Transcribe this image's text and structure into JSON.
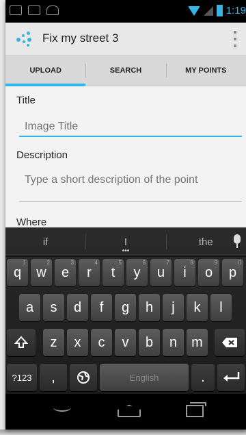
{
  "status_bar": {
    "time": "1:19",
    "icons": [
      "keyboard-icon",
      "image-icon",
      "android-icon",
      "wifi-icon",
      "signal-icon",
      "battery-icon"
    ]
  },
  "action_bar": {
    "title": "Fix my street 3",
    "icon": "app-dots-icon",
    "overflow_icon": "overflow-menu-icon"
  },
  "tabs": [
    {
      "label": "UPLOAD",
      "active": true
    },
    {
      "label": "SEARCH",
      "active": false
    },
    {
      "label": "MY POINTS",
      "active": false
    }
  ],
  "form": {
    "title_label": "Title",
    "title_placeholder": "Image Title",
    "description_label": "Description",
    "description_placeholder": "Type a short description of the point",
    "where_label": "Where"
  },
  "keyboard": {
    "suggestions": [
      "if",
      "I",
      "the"
    ],
    "row1": [
      {
        "key": "q",
        "hint": "1"
      },
      {
        "key": "w",
        "hint": "2"
      },
      {
        "key": "e",
        "hint": "3"
      },
      {
        "key": "r",
        "hint": "4"
      },
      {
        "key": "t",
        "hint": "5"
      },
      {
        "key": "y",
        "hint": "6"
      },
      {
        "key": "u",
        "hint": "7"
      },
      {
        "key": "i",
        "hint": "8"
      },
      {
        "key": "o",
        "hint": "9"
      },
      {
        "key": "p",
        "hint": "0"
      }
    ],
    "row2": [
      "a",
      "s",
      "d",
      "f",
      "g",
      "h",
      "j",
      "k",
      "l"
    ],
    "row3": [
      "z",
      "x",
      "c",
      "v",
      "b",
      "n",
      "m"
    ],
    "symbols_label": "?123",
    "comma_label": ",",
    "space_label": "English",
    "period_label": ".",
    "accent_color": "#33b5e5"
  },
  "nav_bar": {
    "icons": [
      "back-icon",
      "home-icon",
      "recent-apps-icon"
    ]
  }
}
